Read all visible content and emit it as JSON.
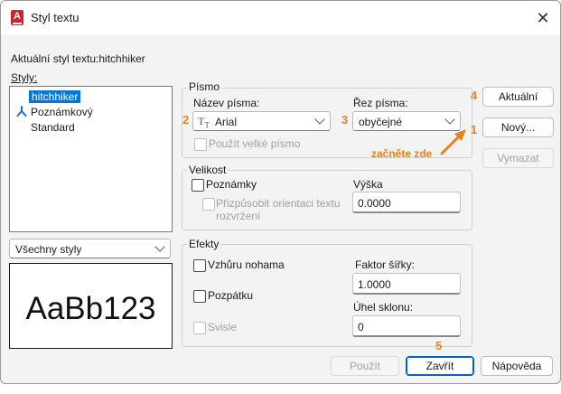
{
  "window": {
    "title": "Styl textu",
    "close_glyph": "✕"
  },
  "current_style_label": "Aktuální styl textu:hitchhiker",
  "styles": {
    "label": "Styly:",
    "items": [
      {
        "label": "hitchhiker",
        "selected": true,
        "icon": null
      },
      {
        "label": "Poznámkový",
        "selected": false,
        "icon": "annotative-icon"
      },
      {
        "label": "Standard",
        "selected": false,
        "icon": null
      }
    ],
    "filter_value": "Všechny styly"
  },
  "preview_text": "AaBb123",
  "font_group": {
    "title": "Písmo",
    "font_name_label": "Název písma:",
    "font_name_value": "Arial",
    "font_style_label": "Řez písma:",
    "font_style_value": "obyčejné",
    "bigfont_label": "Použít velké písmo"
  },
  "size_group": {
    "title": "Velikost",
    "annotative_label": "Poznámky",
    "match_orientation_label": "Přizpůsobit orientaci textu rozvržení",
    "match_line1": "Přizpůsobit orientaci textu",
    "match_line2": "rozvržení",
    "height_label": "Výška",
    "height_value": "0.0000"
  },
  "effects_group": {
    "title": "Efekty",
    "upside_down_label": "Vzhůru nohama",
    "backwards_label": "Pozpátku",
    "vertical_label": "Svisle",
    "width_factor_label": "Faktor šířky:",
    "width_factor_value": "1.0000",
    "oblique_label": "Úhel sklonu:",
    "oblique_value": "0"
  },
  "buttons": {
    "set_current": "Aktuální",
    "new": "Nový...",
    "delete": "Vymazat",
    "apply": "Použít",
    "close": "Zavřít",
    "help": "Nápověda"
  },
  "annotations": {
    "n1": "1",
    "n2": "2",
    "n3": "3",
    "n4": "4",
    "n5": "5",
    "start_here": "začněte zde",
    "color": "#e8821e"
  },
  "colors": {
    "accent": "#0078d7",
    "app_icon": "#d3222a"
  }
}
